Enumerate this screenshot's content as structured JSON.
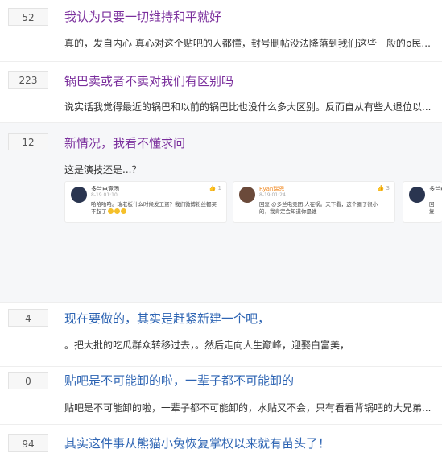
{
  "threads": [
    {
      "count": "52",
      "title": "我认为只要一切维持和平就好",
      "excerpt": "真的，发自内心 真心对这个贴吧的人都懂，封号删帖没法降落到我们这些一般的p民..."
    },
    {
      "count": "223",
      "title": "锅巴卖或者不卖对我们有区别吗",
      "excerpt": "说实话我觉得最近的锅巴和以前的锅巴比也没什么多大区别。反而自从有些人退位以..."
    },
    {
      "count": "12",
      "title": "新情况，我看不懂求问",
      "excerpt": "这是演技还是...？",
      "cards": [
        {
          "name": "多兰电竞团",
          "time": "8-19 01:10",
          "likes": "1",
          "text": "哈哈哈哈。瑞老板什么时候发工资？我们微博粉丝都买不起了"
        },
        {
          "name": "Ryan瑞恩",
          "time": "8-19 01:24",
          "likes": "3",
          "text": "回复 @多兰电竞团:人在锅。天下看，这个圈子很小的，我肯定会知道你是谁"
        },
        {
          "name": "多兰电竞团",
          "time": "",
          "likes": "",
          "text": "回复"
        }
      ]
    },
    {
      "count": "4",
      "title": "现在要做的，其实是赶紧新建一个吧，",
      "excerpt": "。把大批的吃瓜群众转移过去，。然后走向人生巅峰，迎娶白富美，"
    },
    {
      "count": "0",
      "title": "贴吧是不可能卸的啦，一辈子都不可能卸的",
      "excerpt": "贴吧是不可能卸的啦，一辈子都不可能卸的，水贴又不会，只有看看背锅吧的大兄弟..."
    },
    {
      "count": "94",
      "title": "其实这件事从熊猫小兔恢复掌权以来就有苗头了！",
      "excerpt": ""
    }
  ],
  "colors": {
    "link": "#2d64b3",
    "visited": "#7a2e9c",
    "highlight_bg": "#f6f7f9"
  }
}
